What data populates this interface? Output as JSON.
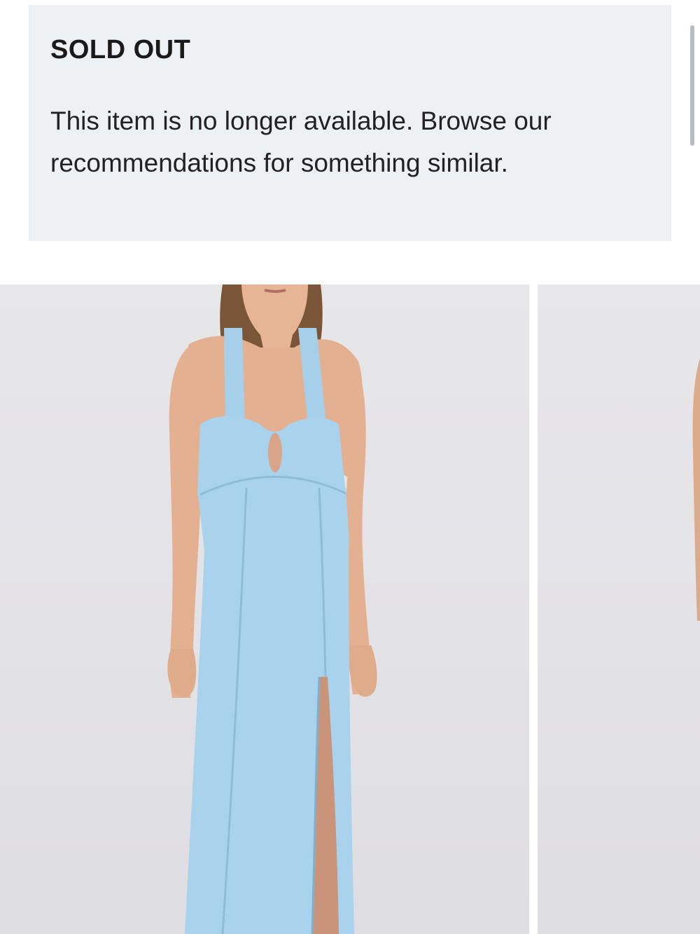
{
  "notice": {
    "title": "SOLD OUT",
    "message": "This item is no longer available. Browse our recommendations for something similar."
  },
  "gallery": {
    "images": [
      {
        "name": "product-image-1",
        "subject": "light blue halter maxi dress with keyhole cutout and front slit"
      },
      {
        "name": "product-image-2",
        "subject": "partial product image"
      }
    ]
  },
  "colors": {
    "notice_bg": "#eef1f4",
    "dress": "#a9d2ec",
    "photo_bg": "#e5e4e8"
  }
}
